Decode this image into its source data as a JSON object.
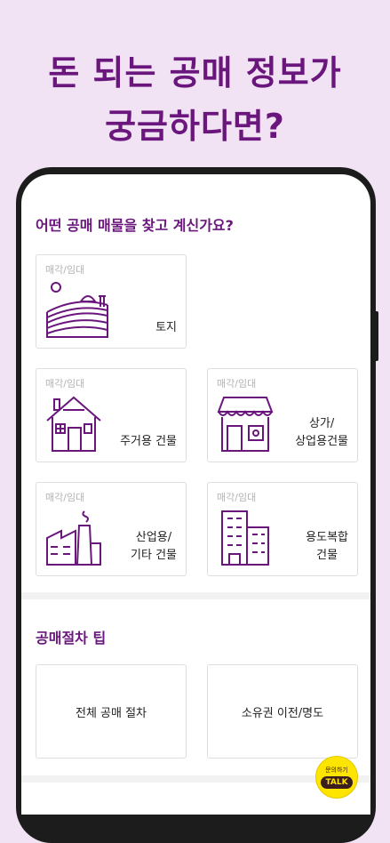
{
  "headline": {
    "line1": "돈 되는 공매 정보가",
    "line2": "궁금하다면?"
  },
  "section1": {
    "title": "어떤 공매 매물을 찾고 계신가요?"
  },
  "categories": [
    {
      "tag": "매각/임대",
      "label_line1": "토지",
      "label_line2": "",
      "icon": "land-icon"
    },
    {
      "tag": "매각/임대",
      "label_line1": "주거용 건물",
      "label_line2": "",
      "icon": "house-icon"
    },
    {
      "tag": "매각/임대",
      "label_line1": "상가/",
      "label_line2": "상업용건물",
      "icon": "store-icon"
    },
    {
      "tag": "매각/임대",
      "label_line1": "산업용/",
      "label_line2": "기타 건물",
      "icon": "factory-icon"
    },
    {
      "tag": "매각/임대",
      "label_line1": "용도복합",
      "label_line2": "건물",
      "icon": "building-icon"
    }
  ],
  "section2": {
    "title": "공매절차 팁"
  },
  "tips": [
    {
      "label": "전체 공매 절차"
    },
    {
      "label": "소유권 이전/명도"
    }
  ],
  "kakao": {
    "top": "문의하기",
    "badge": "TALK"
  },
  "colors": {
    "brand": "#6a167d",
    "background": "#f1e3f3",
    "kakao": "#fee500"
  }
}
